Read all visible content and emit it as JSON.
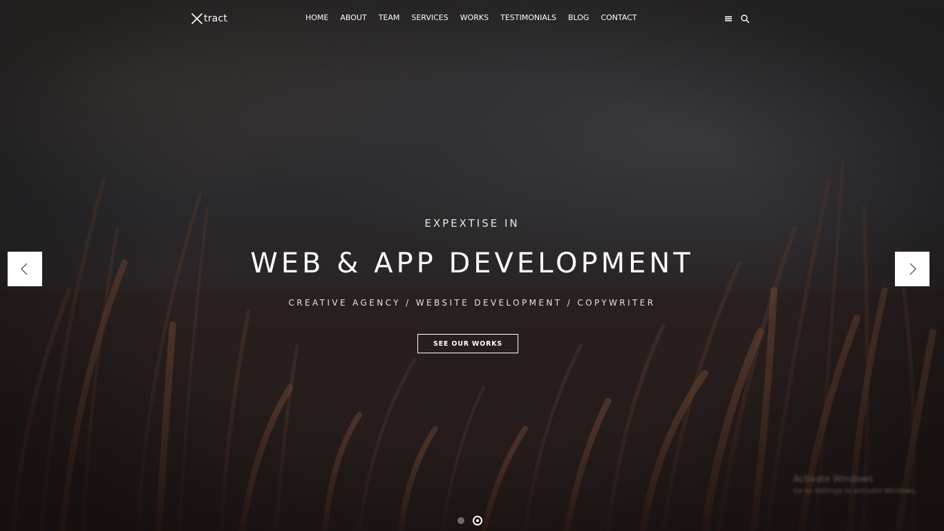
{
  "brand": {
    "logo_text": "tract"
  },
  "nav": {
    "items": [
      {
        "label": "HOME"
      },
      {
        "label": "ABOUT"
      },
      {
        "label": "TEAM"
      },
      {
        "label": "SERVICES"
      },
      {
        "label": "WORKS"
      },
      {
        "label": "TESTIMONIALS"
      },
      {
        "label": "BLOG"
      },
      {
        "label": "CONTACT"
      }
    ],
    "icons": [
      "menu-icon",
      "search-icon"
    ]
  },
  "hero": {
    "eyebrow": "EXPEXTISE IN",
    "headline": "WEB & APP DEVELOPMENT",
    "subline": "CREATIVE AGENCY / WEBSITE DEVELOPMENT / COPYWRITER",
    "cta_label": "SEE OUR WORKS"
  },
  "slider": {
    "prev_icon": "chevron-left-icon",
    "next_icon": "chevron-right-icon",
    "slide_count": 2,
    "active_slide": 2
  },
  "watermark": {
    "title": "Activate Windows",
    "subtitle": "Go to Settings to activate Windows."
  },
  "colors": {
    "text": "#ffffff",
    "arrow_bg": "#ffffff",
    "arrow_fg": "#555555",
    "dot_inactive": "#6c6a6b"
  }
}
